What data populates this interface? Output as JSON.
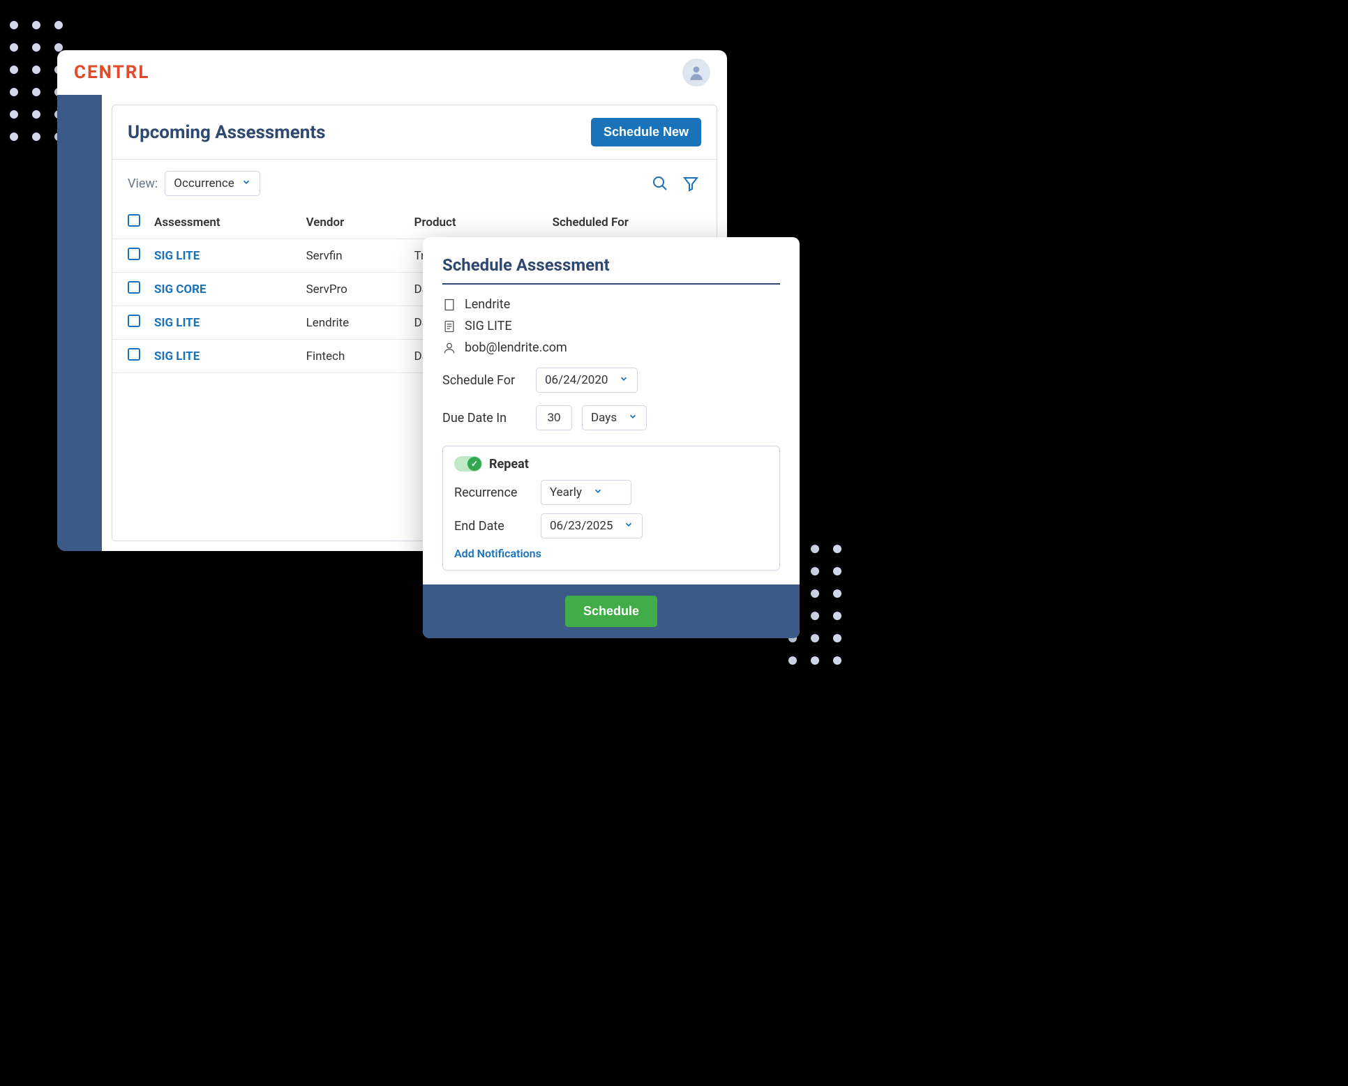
{
  "brand": "CENTRL",
  "page": {
    "title": "Upcoming Assessments",
    "schedule_new_label": "Schedule New",
    "view_label": "View:",
    "view_value": "Occurrence",
    "columns": {
      "assessment": "Assessment",
      "vendor": "Vendor",
      "product": "Product",
      "scheduled_for": "Scheduled For"
    },
    "rows": [
      {
        "assessment": "SIG LITE",
        "vendor": "Servfin",
        "product": "TrafficView"
      },
      {
        "assessment": "SIG CORE",
        "vendor": "ServPro",
        "product": "Data Cent"
      },
      {
        "assessment": "SIG LITE",
        "vendor": "Lendrite",
        "product": "Data Anal"
      },
      {
        "assessment": "SIG LITE",
        "vendor": "Fintech",
        "product": "Data Store"
      }
    ]
  },
  "modal": {
    "title": "Schedule Assessment",
    "vendor": "Lendrite",
    "assessment": "SIG LITE",
    "contact": "bob@lendrite.com",
    "schedule_for_label": "Schedule For",
    "schedule_for_value": "06/24/2020",
    "due_date_label": "Due Date In",
    "due_date_value": "30",
    "due_date_unit": "Days",
    "repeat": {
      "label": "Repeat",
      "on": true,
      "recurrence_label": "Recurrence",
      "recurrence_value": "Yearly",
      "end_date_label": "End Date",
      "end_date_value": "06/23/2025"
    },
    "add_notifications_label": "Add Notifications",
    "schedule_button_label": "Schedule"
  },
  "icons": {
    "search": "search-icon",
    "filter": "filter-icon",
    "avatar": "user-avatar-icon",
    "chevron_down": "chevron-down-icon",
    "building": "building-icon",
    "document": "document-icon",
    "person": "person-icon"
  }
}
